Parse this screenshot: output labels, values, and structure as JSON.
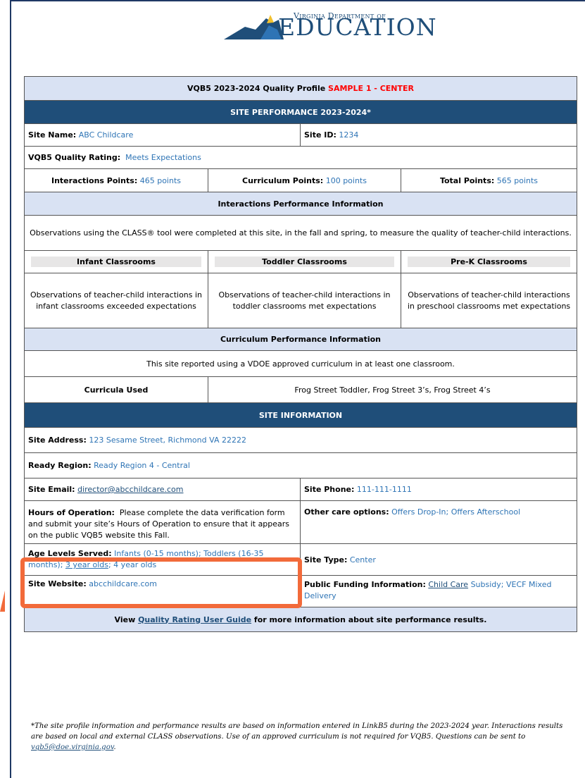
{
  "logo": {
    "small_text": "Virginia Department of",
    "big_text": "EDUCATION"
  },
  "profile": {
    "title_prefix": "VQB5 2023-2024 Quality Profile ",
    "title_sample": "SAMPLE 1 - CENTER",
    "site_performance_header": "SITE PERFORMANCE 2023-2024*",
    "site_name_label": "Site Name:",
    "site_name": "ABC Childcare",
    "site_id_label": "Site ID:",
    "site_id": "1234",
    "rating_label": "VQB5 Quality Rating:",
    "rating": "Meets Expectations",
    "interactions_points_label": "Interactions Points:",
    "interactions_points": "465 points",
    "curriculum_points_label": "Curriculum Points:",
    "curriculum_points": "100 points",
    "total_points_label": "Total Points:",
    "total_points": "565 points",
    "interactions_header": "Interactions Performance Information",
    "interactions_desc": "Observations using the CLASS® tool were completed at this site, in the fall and spring, to measure the quality of teacher-child interactions.",
    "classrooms": [
      {
        "name": "Infant Classrooms",
        "result": "Observations of teacher-child interactions in infant classrooms exceeded expectations"
      },
      {
        "name": "Toddler Classrooms",
        "result": "Observations of teacher-child interactions in toddler classrooms met expectations"
      },
      {
        "name": "Pre-K Classrooms",
        "result": "Observations of teacher-child interactions in preschool classrooms met expectations"
      }
    ],
    "curriculum_header": "Curriculum Performance Information",
    "curriculum_desc": "This site reported using a VDOE approved curriculum in at least one classroom.",
    "curricula_used_label": "Curricula Used",
    "curricula_used": "Frog Street Toddler, Frog Street 3’s, Frog Street 4’s",
    "site_info_header": "SITE INFORMATION",
    "address_label": "Site Address:",
    "address": "123 Sesame Street, Richmond VA 22222",
    "region_label": "Ready Region:",
    "region": "Ready Region 4 - Central",
    "email_label": "Site Email:",
    "email": "director@abcchildcare.com",
    "phone_label": "Site Phone:",
    "phone": "111-111-1111",
    "hours_label": "Hours of Operation:",
    "hours_text": "Please complete the data verification form and submit your site’s Hours of Operation to ensure that it appears on the public VQB5 website this Fall.",
    "other_care_label": "Other care options:",
    "other_care": "Offers Drop-In; Offers Afterschool",
    "age_levels_label": "Age Levels Served:",
    "age_levels_a": "Infants (0-15 months); Toddlers (16-35 months);",
    "age_levels_link": "3 year olds",
    "age_levels_b": "; 4 year olds",
    "site_type_label": "Site Type:",
    "site_type": "Center",
    "website_label": "Site Website:",
    "website": "abcchildcare.com",
    "funding_label": "Public Funding Information:",
    "funding_link": "Child Care",
    "funding_rest": " Subsidy; VECF Mixed Delivery",
    "guide_prefix": "View ",
    "guide_link": "Quality Rating User Guide",
    "guide_suffix": " for more information about site performance results."
  },
  "footnote": {
    "text": "*The site profile information and performance results are based on information entered in LinkB5 during the 2023-2024 year.  Interactions results are based on local and external CLASS observations.  Use of an approved curriculum is not required for VQB5. Questions can be sent to ",
    "email": "vqb5@doe.virginia.gov",
    "end": "."
  },
  "colors": {
    "header_dark": "#1f4e79",
    "header_light": "#d9e2f3",
    "value_blue": "#2e74b5",
    "highlight": "#f26a3a"
  }
}
